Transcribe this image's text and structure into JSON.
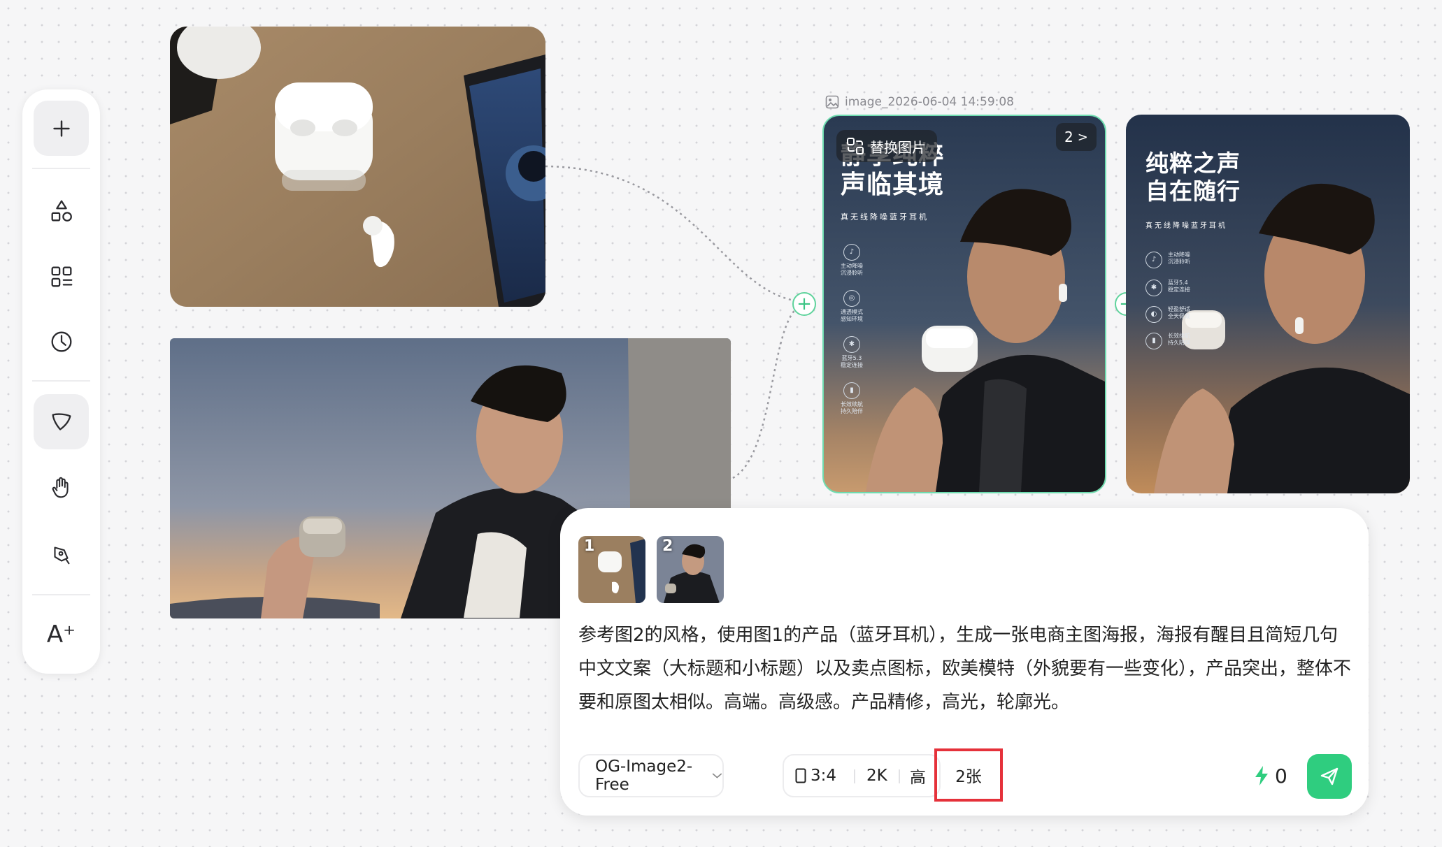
{
  "toolbar": {
    "items": [
      {
        "name": "add"
      },
      {
        "name": "shapes"
      },
      {
        "name": "components"
      },
      {
        "name": "history"
      },
      {
        "name": "select"
      },
      {
        "name": "hand"
      },
      {
        "name": "pen"
      },
      {
        "name": "text-ai",
        "label": "A⁺"
      }
    ],
    "active": "select"
  },
  "canvas": {
    "image_label": "image_2026-06-04 14:59:08",
    "replace_button": "替换图片",
    "count_badge": "2",
    "poster1": {
      "title": "静享纯粹\n声临其境",
      "subtitle": "真无线降噪蓝牙耳机",
      "features": [
        "主动降噪\n沉浸聆听",
        "通透模式\n感知环境",
        "蓝牙5.3\n稳定连接",
        "长效续航\n持久陪伴"
      ]
    },
    "poster2": {
      "title": "纯粹之声\n自在随行",
      "subtitle": "真无线降噪蓝牙耳机",
      "features": [
        "主动降噪\n沉浸聆听",
        "蓝牙5.4\n稳定连接",
        "轻盈舒适\n全天佩戴",
        "长效续航\n持久陪伴"
      ]
    }
  },
  "prompt_panel": {
    "thumbnails": [
      {
        "number": "1"
      },
      {
        "number": "2"
      }
    ],
    "prompt_text": "参考图2的风格，使用图1的产品（蓝牙耳机），生成一张电商主图海报，海报有醒目且简短几句中文文案（大标题和小标题）以及卖点图标，欧美模特（外貌要有一些变化），产品突出，整体不要和原图太相似。高端。高级感。产品精修，高光，轮廓光。",
    "model": "OG-Image2-Free",
    "aspect_ratio": "3:4",
    "resolution": "2K",
    "quality": "高",
    "count": "2张",
    "credits": "0"
  },
  "colors": {
    "accent": "#2fcd7f",
    "highlight": "#e5313a",
    "selection": "#6fdcb0"
  }
}
